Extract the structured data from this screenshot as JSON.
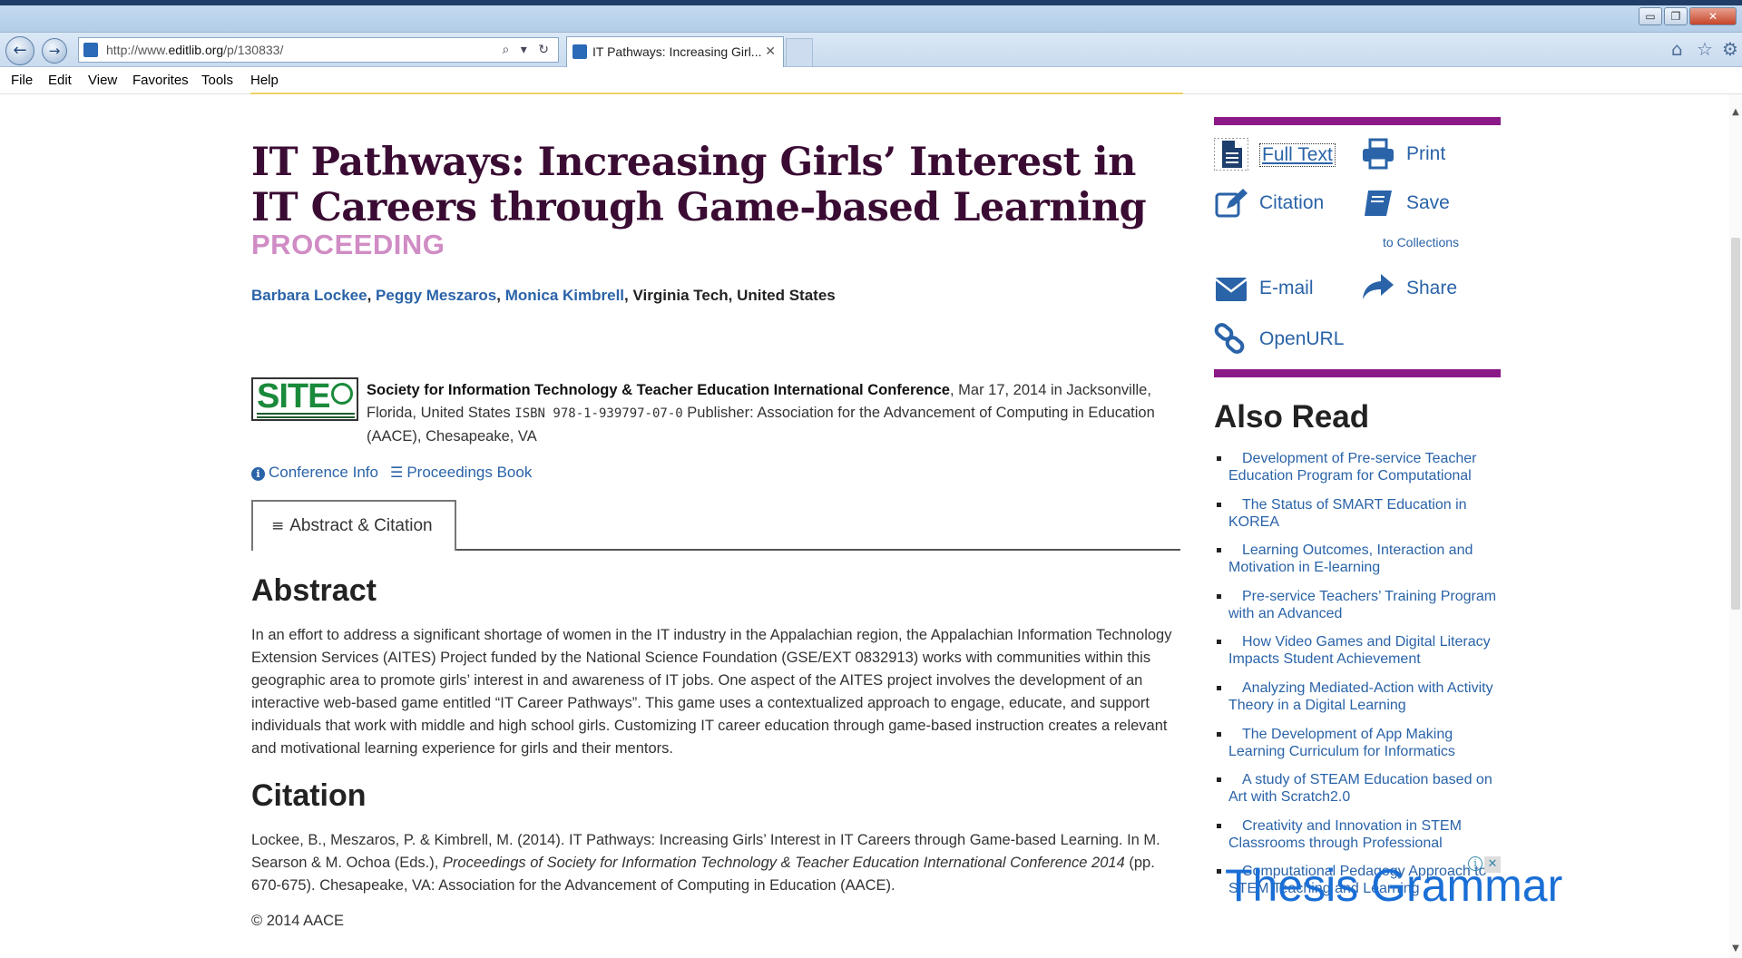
{
  "browser": {
    "url_prefix": "http://www.",
    "url_domain": "editlib.org",
    "url_path": "/p/130833/",
    "address_tools": "⌕ ▾ ↻",
    "tab_title": "IT Pathways: Increasing Girl...",
    "tab_close": "✕",
    "menu": [
      "File",
      "Edit",
      "View",
      "Favorites",
      "Tools",
      "Help"
    ],
    "window_buttons": {
      "minimize": "▭",
      "restore": "❐",
      "close": "✕"
    }
  },
  "article": {
    "title": "IT Pathways: Increasing Girls’ Interest in IT Careers through Game-based Learning",
    "type": "PROCEEDING",
    "authors": [
      "Barbara Lockee",
      "Peggy Meszaros",
      "Monica Kimbrell"
    ],
    "affiliation": "Virginia Tech, United States",
    "logo_text": "SITE",
    "conference_name": "Society for Information Technology & Teacher Education International Conference",
    "conference_details": ", Mar 17, 2014 in Jacksonville, Florida, United States",
    "isbn": "ISBN 978-1-939797-07-0",
    "publisher": "Publisher: Association for the Advancement of Computing in Education (AACE), Chesapeake, VA",
    "conference_info_link": "Conference Info",
    "proceedings_link": "Proceedings Book",
    "tab_label": "Abstract & Citation",
    "abstract_heading": "Abstract",
    "abstract": "In an effort to address a significant shortage of women in the IT industry in the Appalachian region, the Appalachian Information Technology Extension Services (AITES) Project funded by the National Science Foundation (GSE/EXT 0832913) works with communities within this geographic area to promote girls’ interest in and awareness of IT jobs. One aspect of the AITES project involves the development of an interactive web-based game entitled “IT Career Pathways”. This game uses a contextualized approach to engage, educate, and support individuals that work with middle and high school girls. Customizing IT career education through game-based instruction creates a relevant and motivational learning experience for girls and their mentors.",
    "citation_heading": "Citation",
    "citation_pre": "Lockee, B., Meszaros, P. & Kimbrell, M. (2014). IT Pathways: Increasing Girls’ Interest in IT Careers through Game-based Learning. In M. Searson & M. Ochoa (Eds.), ",
    "citation_italic": "Proceedings of Society for Information Technology & Teacher Education International Conference 2014",
    "citation_post": " (pp. 670-675). Chesapeake, VA: Association for the Advancement of Computing in Education (AACE).",
    "copyright": "© 2014 AACE"
  },
  "sidebar": {
    "actions": {
      "full_text": "Full Text",
      "print": "Print",
      "citation": "Citation",
      "save": "Save",
      "save_sub": "to Collections",
      "email": "E-mail",
      "share": "Share",
      "openurl": "OpenURL"
    },
    "also_read_title": "Also Read",
    "also_read": [
      "Development of Pre-service Teacher Education Program for Computational",
      "The Status of SMART Education in KOREA",
      "Learning Outcomes, Interaction and Motivation in E-learning",
      "Pre-service Teachers’ Training Program with an Advanced",
      "How Video Games and Digital Literacy Impacts Student Achievement",
      "Analyzing Mediated-Action with Activity Theory in a Digital Learning",
      "The Development of App Making Learning Curriculum for Informatics",
      "A study of STEAM Education based on Art with Scratch2.0",
      "Creativity and Innovation in STEM Classrooms through Professional",
      "Computational Pedagogy Approach to STEM Teaching and Learning"
    ],
    "ad_text": "Thesis Grammar",
    "accent_color": "#8b1a88",
    "link_color": "#2a63a8"
  }
}
